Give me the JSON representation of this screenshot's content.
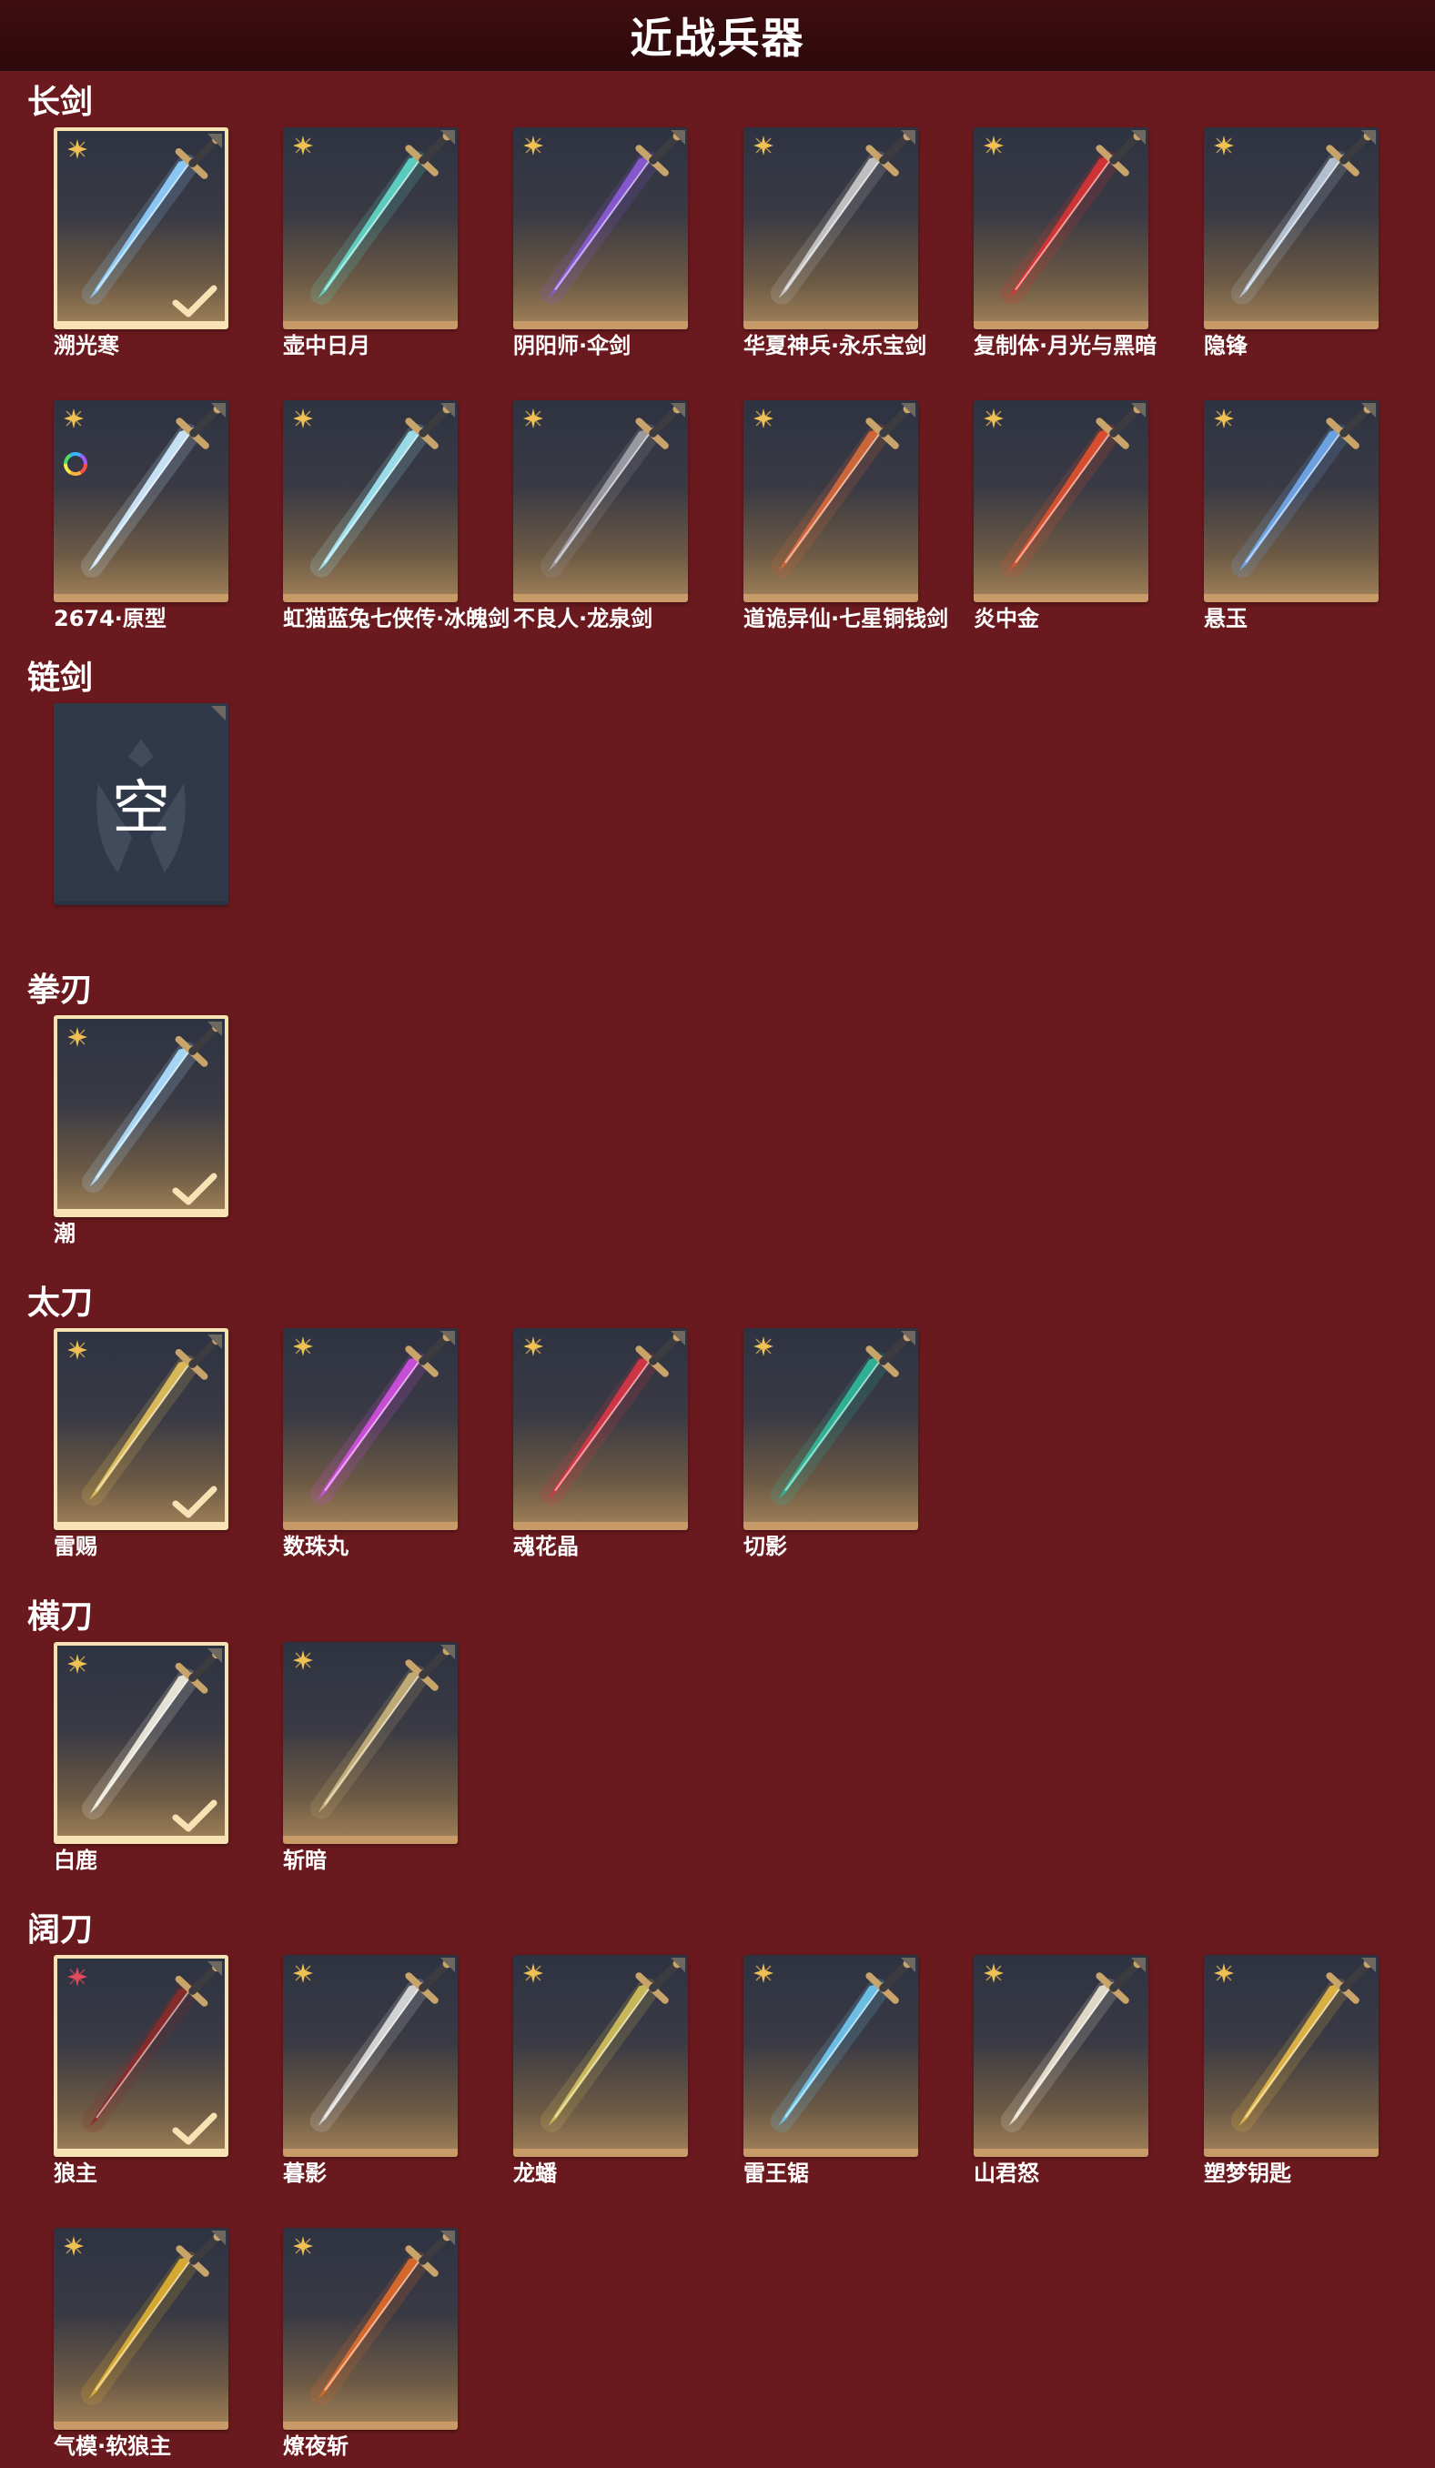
{
  "page_title": "近战兵器",
  "colors": {
    "background": "#6a1a1e",
    "header": "#2c090b",
    "selected_border": "#f6e2b3",
    "rarity_gold": "#f0c155",
    "rarity_red": "#e04a5a"
  },
  "empty_label": "空",
  "sections": [
    {
      "title": "长剑",
      "items": [
        {
          "name": "溯光寒",
          "selected": true,
          "rarity": "gold",
          "icon": "ice-crystal-sword-icon",
          "blade": "#8fd0ff"
        },
        {
          "name": "壶中日月",
          "selected": false,
          "rarity": "gold",
          "icon": "jade-sword-icon",
          "blade": "#5fd6c8"
        },
        {
          "name": "阴阳师·伞剑",
          "selected": false,
          "rarity": "gold",
          "icon": "umbrella-sword-icon",
          "blade": "#8a5ad6"
        },
        {
          "name": "华夏神兵·永乐宝剑",
          "selected": false,
          "rarity": "gold",
          "icon": "bronze-sword-icon",
          "blade": "#c9c9c9"
        },
        {
          "name": "复制体·月光与黑暗",
          "selected": false,
          "rarity": "gold",
          "icon": "crescent-blade-icon",
          "blade": "#d83333"
        },
        {
          "name": "隐锋",
          "selected": false,
          "rarity": "gold",
          "icon": "red-hilt-sword-icon",
          "blade": "#b8c8d8"
        },
        {
          "name": "2674·原型",
          "selected": false,
          "rarity": "gold",
          "icon": "light-sword-icon",
          "blade": "#cfeaff",
          "mod": true
        },
        {
          "name": "虹猫蓝兔七侠传·冰魄剑",
          "selected": false,
          "rarity": "gold",
          "icon": "cyan-sword-icon",
          "blade": "#9fe6f2"
        },
        {
          "name": "不良人·龙泉剑",
          "selected": false,
          "rarity": "gold",
          "icon": "dark-ornate-sword-icon",
          "blade": "#a0a0a8"
        },
        {
          "name": "道诡异仙·七星铜钱剑",
          "selected": false,
          "rarity": "gold",
          "icon": "coin-sword-icon",
          "blade": "#d6683a"
        },
        {
          "name": "炎中金",
          "selected": false,
          "rarity": "gold",
          "icon": "flame-sword-icon",
          "blade": "#e0502e"
        },
        {
          "name": "悬玉",
          "selected": false,
          "rarity": "gold",
          "icon": "blue-sword-icon",
          "blade": "#6fa8ea"
        }
      ]
    },
    {
      "title": "链剑",
      "items": [
        {
          "name": "",
          "selected": false,
          "empty": true
        }
      ]
    },
    {
      "title": "拳刃",
      "items": [
        {
          "name": "潮",
          "selected": true,
          "rarity": "gold",
          "icon": "ice-claw-icon",
          "blade": "#aee0ff"
        }
      ]
    },
    {
      "title": "太刀",
      "items": [
        {
          "name": "雷赐",
          "selected": true,
          "rarity": "gold",
          "icon": "golden-katana-icon",
          "blade": "#e3c15a"
        },
        {
          "name": "数珠丸",
          "selected": false,
          "rarity": "gold",
          "icon": "purple-katana-icon",
          "blade": "#d04fe0"
        },
        {
          "name": "魂花晶",
          "selected": false,
          "rarity": "gold",
          "icon": "crimson-katana-icon",
          "blade": "#d83545"
        },
        {
          "name": "切影",
          "selected": false,
          "rarity": "gold",
          "icon": "jade-katana-icon",
          "blade": "#2fb89a"
        }
      ]
    },
    {
      "title": "横刀",
      "items": [
        {
          "name": "白鹿",
          "selected": true,
          "rarity": "gold",
          "icon": "white-deer-blade-icon",
          "blade": "#f0ede0"
        },
        {
          "name": "斩暗",
          "selected": false,
          "rarity": "gold",
          "icon": "golden-dual-blade-icon",
          "blade": "#c9b27a"
        }
      ]
    },
    {
      "title": "阔刀",
      "items": [
        {
          "name": "狼主",
          "selected": true,
          "rarity": "red",
          "icon": "wolf-broadsword-icon",
          "blade": "#8a2a2a"
        },
        {
          "name": "暮影",
          "selected": false,
          "rarity": "gold",
          "icon": "silver-broadsword-icon",
          "blade": "#dcdcdc"
        },
        {
          "name": "龙蟠",
          "selected": false,
          "rarity": "gold",
          "icon": "dragon-broadsword-icon",
          "blade": "#d2c05a"
        },
        {
          "name": "雷王锯",
          "selected": false,
          "rarity": "gold",
          "icon": "thunder-saw-icon",
          "blade": "#6fc7ef"
        },
        {
          "name": "山君怒",
          "selected": false,
          "rarity": "gold",
          "icon": "tiger-broadsword-icon",
          "blade": "#ebe3d0"
        },
        {
          "name": "塑梦钥匙",
          "selected": false,
          "rarity": "gold",
          "icon": "dream-key-icon",
          "blade": "#e6b944"
        },
        {
          "name": "气模·软狼主",
          "selected": false,
          "rarity": "gold",
          "icon": "soft-wolf-broadsword-icon",
          "blade": "#e0b030"
        },
        {
          "name": "燎夜斩",
          "selected": false,
          "rarity": "gold",
          "icon": "ember-broadsword-icon",
          "blade": "#e06a2a"
        }
      ]
    }
  ]
}
